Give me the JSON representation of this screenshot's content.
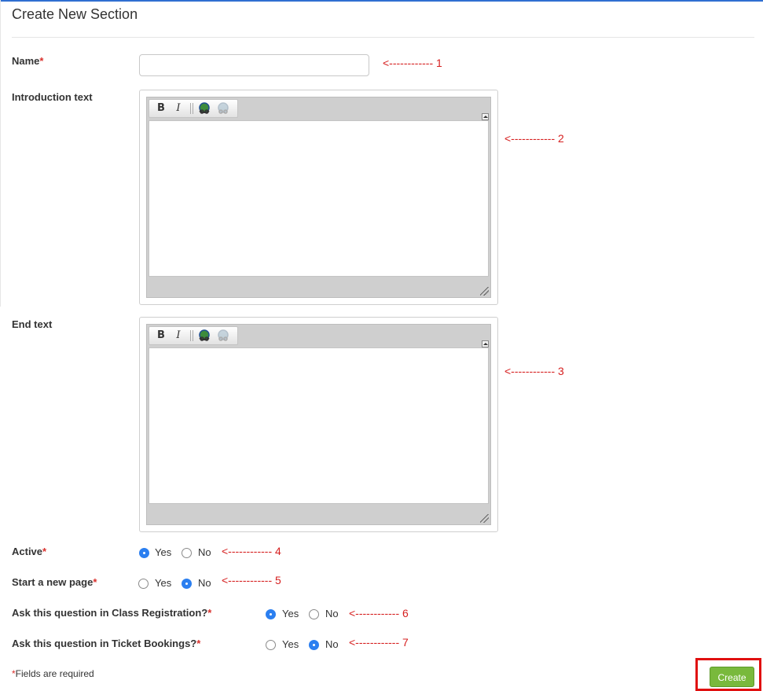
{
  "page": {
    "title": "Create New Section"
  },
  "fields": {
    "name": {
      "label": "Name",
      "required_mark": "*",
      "value": ""
    },
    "intro": {
      "label": "Introduction text"
    },
    "end": {
      "label": "End text"
    },
    "active": {
      "label": "Active",
      "required_mark": "*",
      "yes": "Yes",
      "no": "No",
      "selected": "Yes"
    },
    "new_page": {
      "label": "Start a new page",
      "required_mark": "*",
      "yes": "Yes",
      "no": "No",
      "selected": "No"
    },
    "class_reg": {
      "label": "Ask this question in Class Registration?",
      "required_mark": "*",
      "yes": "Yes",
      "no": "No",
      "selected": "Yes"
    },
    "ticket": {
      "label": "Ask this question in Ticket Bookings?",
      "required_mark": "*",
      "yes": "Yes",
      "no": "No",
      "selected": "No"
    }
  },
  "editor_toolbar": {
    "bold": "B",
    "italic": "I",
    "icons": [
      "bold-icon",
      "italic-icon",
      "link-icon",
      "unlink-icon"
    ]
  },
  "annotations": {
    "a1": "<------------ 1",
    "a2": "<------------ 2",
    "a3": "<------------ 3",
    "a4": "<------------ 4",
    "a5": "<------------ 5",
    "a6": "<------------ 6",
    "a7": "<------------ 7"
  },
  "footer": {
    "required_mark": "*",
    "note": "Fields are required",
    "create": "Create"
  },
  "colors": {
    "accent": "#2b7ff0",
    "create_button": "#79b93c",
    "required": "#d9302c",
    "annotation": "#d62020",
    "highlight_box": "#e01010"
  }
}
